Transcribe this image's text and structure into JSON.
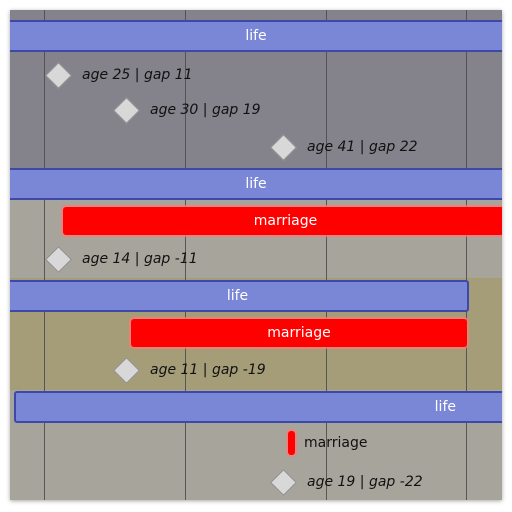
{
  "rows": [
    {
      "id": "g1",
      "life_label": "life",
      "milestones": [
        {
          "label": "age 25 | gap 11"
        },
        {
          "label": "age 30 | gap 19"
        },
        {
          "label": "age 41 | gap 22"
        }
      ]
    },
    {
      "id": "g2",
      "life_label": "life",
      "marriage_label": "marriage",
      "milestones": [
        {
          "label": "age 14 | gap -11"
        }
      ]
    },
    {
      "id": "g3",
      "life_label": "life",
      "marriage_label": "marriage",
      "milestones": [
        {
          "label": "age 11 | gap -19"
        }
      ]
    },
    {
      "id": "g4",
      "life_label": "life",
      "marriage_label": "marriage",
      "milestones": [
        {
          "label": "age 19 | gap -22"
        }
      ]
    }
  ],
  "colors": {
    "band_dark": "#84838b",
    "band_gray": "#a7a49c",
    "band_olive": "#a49d78",
    "life_fill": "#7a86d6",
    "life_border": "#3d48a8",
    "marriage_fill": "#ff0000"
  }
}
